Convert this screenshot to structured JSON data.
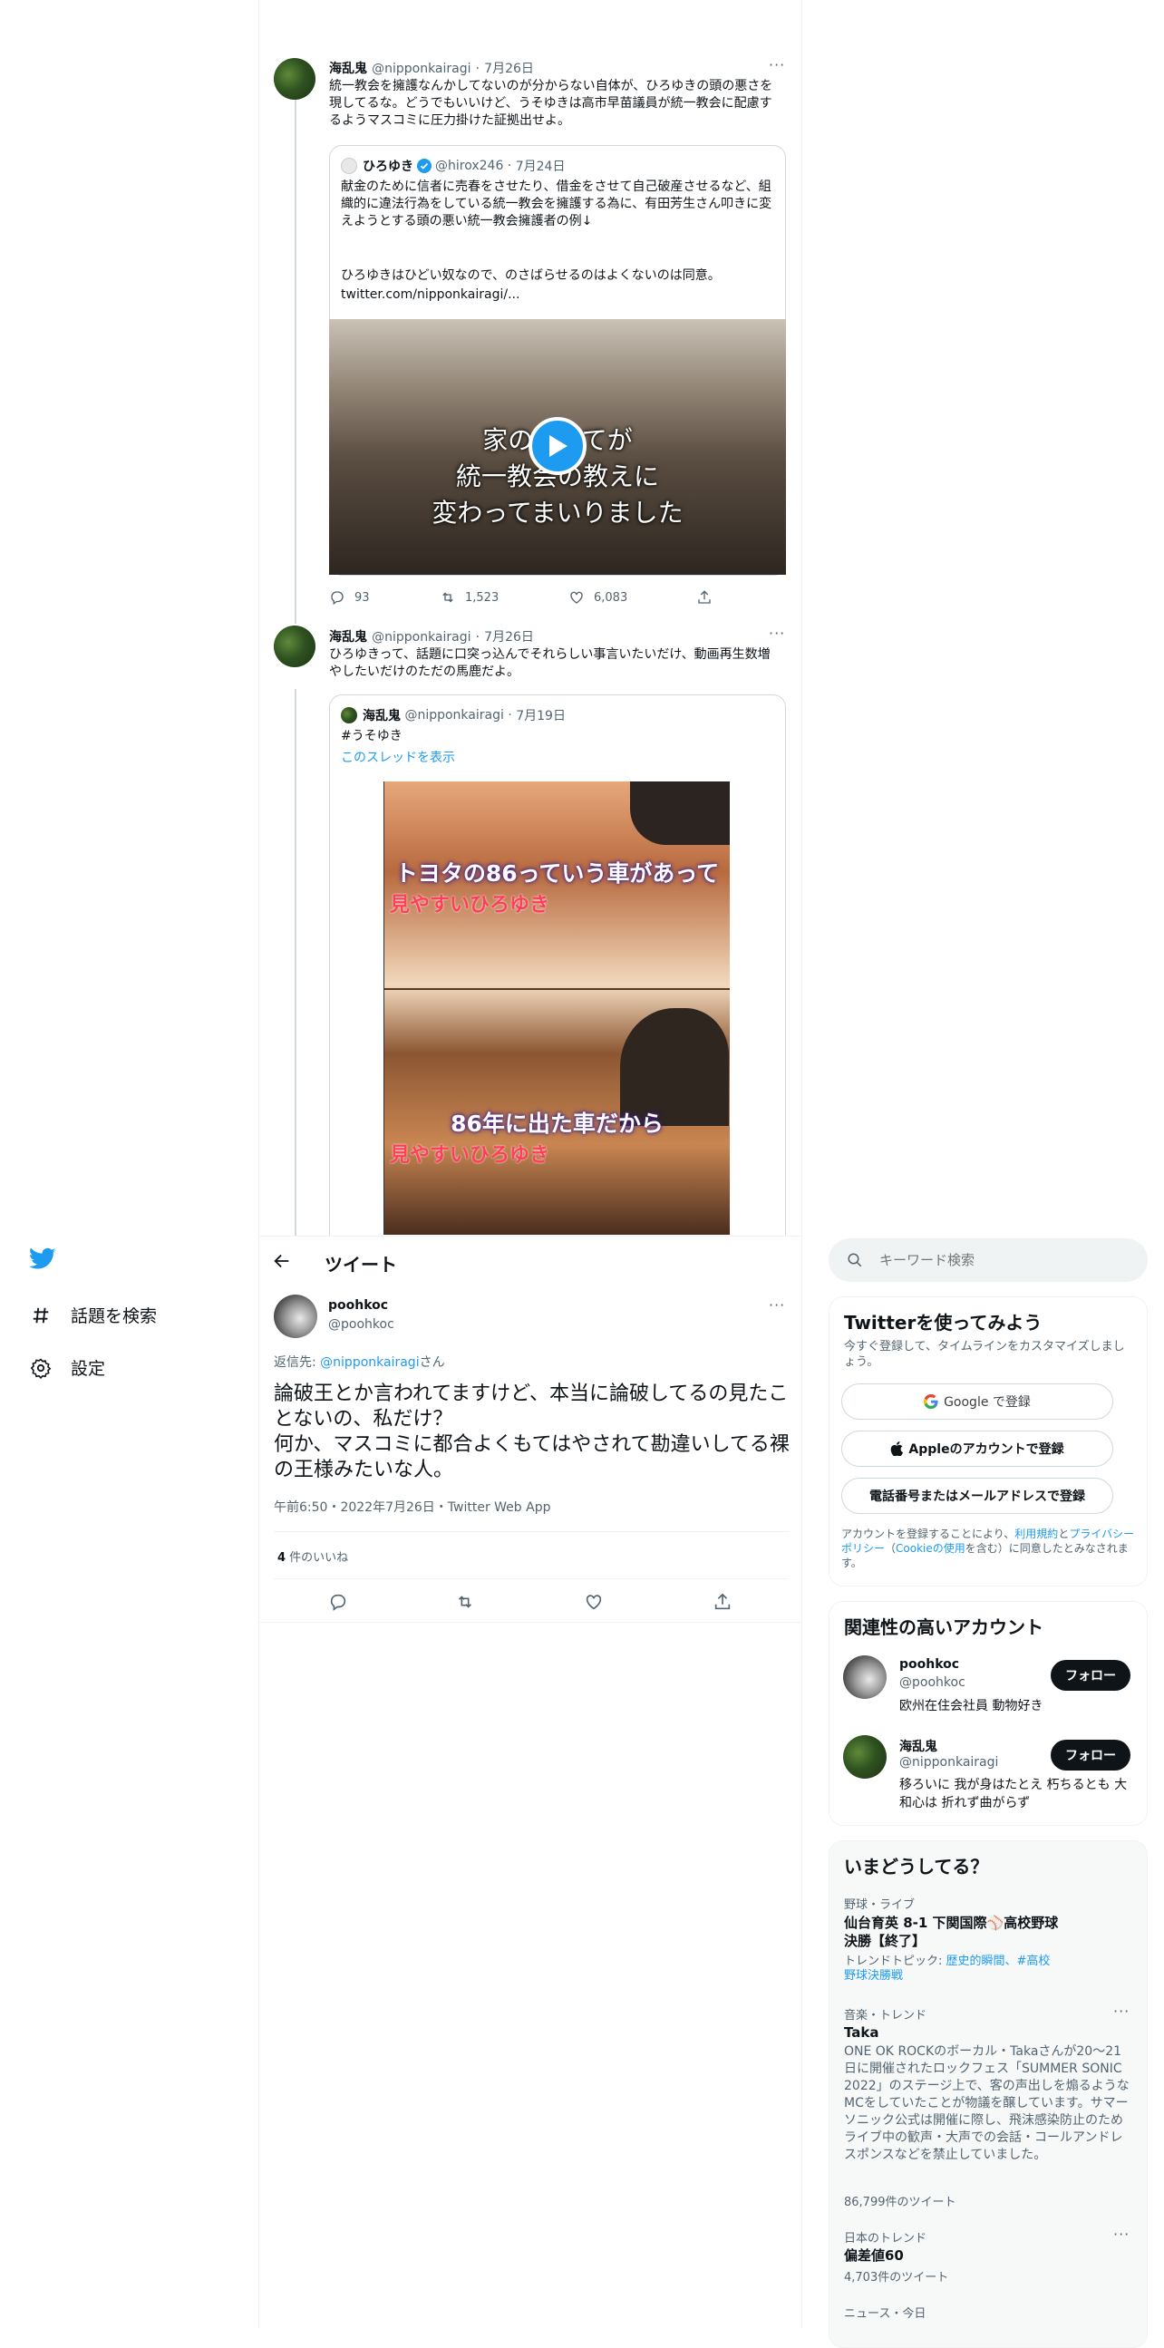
{
  "nav": {
    "explore_label": "話題を検索",
    "settings_label": "設定"
  },
  "thread": [
    {
      "author_name": "海乱鬼",
      "author_handle": "@nipponkairagi",
      "date": "7月26日",
      "text": "統一教会を擁護なんかしてないのが分からない自体が、ひろゆきの頭の悪さを現してるな。どうでもいいけど、うそゆきは高市早苗議員が統一教会に配慮するようマスコミに圧力掛けた証拠出せよ。",
      "quote": {
        "author_name": "ひろゆき",
        "author_handle": "@hirox246",
        "date": "7月24日",
        "text1": "献金のために信者に売春をさせたり、借金をさせて自己破産させるなど、組織的に違法行為をしている統一教会を擁護する為に、有田芳生さん叩きに変えようとする頭の悪い統一教会擁護者の例↓",
        "text2": "ひろゆきはひどい奴なので、のさばらせるのはよくないのは同意。",
        "link": "twitter.com/nipponkairagi/...",
        "video_caption": [
          "家の",
          "てが",
          "統一教会の教えに",
          "変わってまいりました"
        ]
      },
      "replies": "93",
      "retweets": "1,523",
      "likes": "6,083"
    },
    {
      "author_name": "海乱鬼",
      "author_handle": "@nipponkairagi",
      "date": "7月26日",
      "text": "ひろゆきって、話題に口突っ込んでそれらしい事言いたいだけ、動画再生数増やしたいだけのただの馬鹿だよ。",
      "quote": {
        "author_name": "海乱鬼",
        "author_handle": "@nipponkairagi",
        "date": "7月19日",
        "text": "#うそゆき",
        "show_thread": "このスレッドを表示",
        "video_caption": [
          "トヨタの86っていう車があって",
          "見やすいひろゆき",
          "86年に出た車だから",
          "見やすいひろゆき"
        ]
      }
    }
  ],
  "header": {
    "title": "ツイート"
  },
  "main_tweet": {
    "author_name": "poohkoc",
    "author_handle": "@poohkoc",
    "reply_prefix": "返信先: ",
    "reply_to": "@nipponkairagi",
    "reply_suffix": "さん",
    "text_line1": "論破王とか言われてますけど、本当に論破してるの見たことないの、私だけ？",
    "text_line2": "何か、マスコミに都合よくもてはやされて勘違いしてる裸の王様みたいな人。",
    "timestamp": "午前6:50・2022年7月26日・Twitter Web App",
    "likes_count": "4",
    "likes_label": " 件のいいね"
  },
  "search": {
    "placeholder": "キーワード検索"
  },
  "signup": {
    "title": "Twitterを使ってみよう",
    "subtitle": "今すぐ登録して、タイムラインをカスタマイズしましょう。",
    "google_button": "Google で登録",
    "apple_button": "Appleのアカウントで登録",
    "phone_button": "電話番号またはメールアドレスで登録",
    "legal_1": "アカウントを登録することにより、",
    "legal_terms": "利用規約",
    "legal_2": "と",
    "legal_privacy": "プライバシーポリシー",
    "legal_3": "（",
    "legal_cookie": "Cookieの使用",
    "legal_4": "を含む）に同意したとみなされます。"
  },
  "relevant": {
    "title": "関連性の高いアカウント",
    "accounts": [
      {
        "name": "poohkoc",
        "handle": "@poohkoc",
        "bio": "欧州在住会社員 動物好き",
        "follow_label": "フォロー"
      },
      {
        "name": "海乱鬼",
        "handle": "@nipponkairagi",
        "bio": "移ろいに 我が身はたとえ 朽ちるとも 大和心は 折れず曲がらず",
        "follow_label": "フォロー"
      }
    ]
  },
  "trends": {
    "title": "いまどうしてる？",
    "items": [
      {
        "meta": "野球・ライブ",
        "title": "仙台育英 8-1 下関国際⚾高校野球決勝【終了】",
        "topic_prefix": "トレンドトピック: ",
        "topic_links": "歴史的瞬間、#高校野球決勝戦"
      },
      {
        "meta": "音楽・トレンド",
        "title": "Taka",
        "desc": "ONE OK ROCKのボーカル・Takaさんが20～21日に開催されたロックフェス「SUMMER SONIC 2022」のステージ上で、客の声出しを煽るようなMCをしていたことが物議を醸しています。サマーソニック公式は開催に際し、飛沫感染防止のためライブ中の歓声・大声での会話・コールアンドレスポンスなどを禁止していました。",
        "count": "86,799件のツイート"
      },
      {
        "meta": "日本のトレンド",
        "title": "偏差値60",
        "count": "4,703件のツイート"
      },
      {
        "meta": "ニュース・今日",
        "title": ""
      }
    ]
  },
  "colors": {
    "accent": "#1d9bf0",
    "text": "#0f1419",
    "muted": "#536471",
    "border": "#eff3f4"
  }
}
